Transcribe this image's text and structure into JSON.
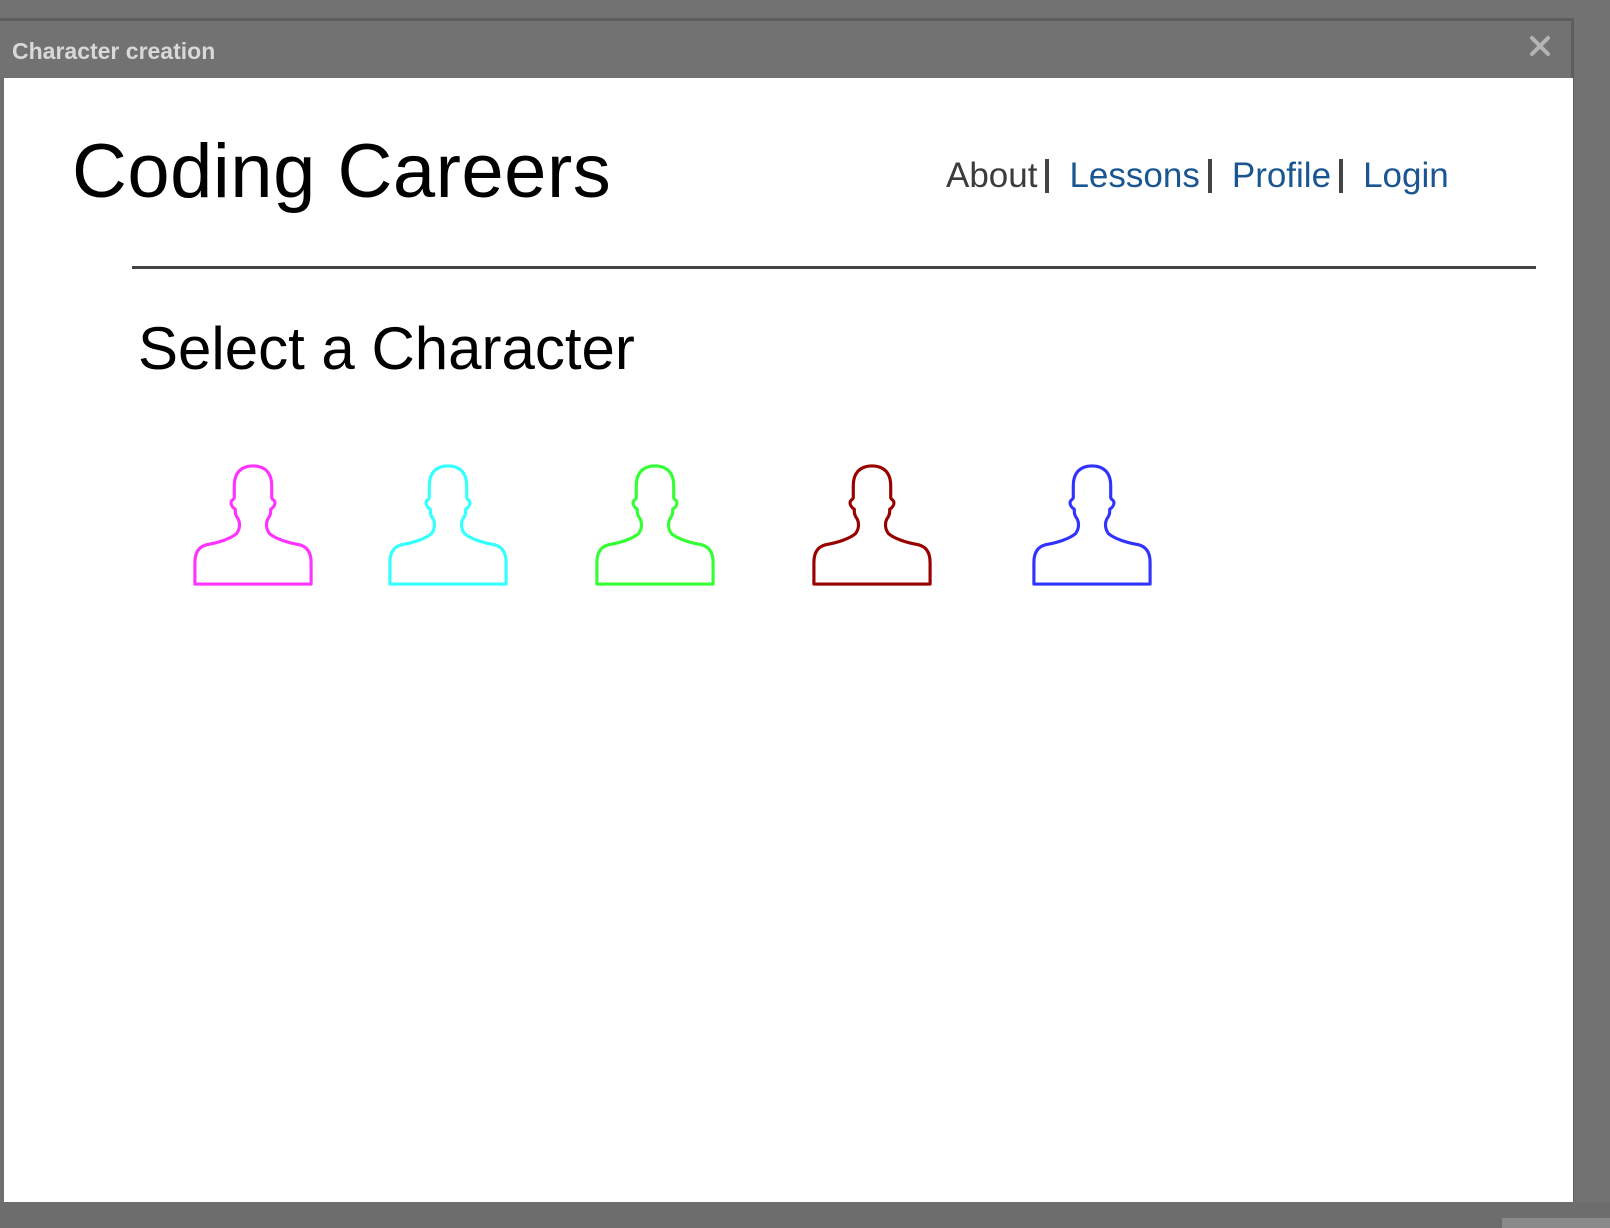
{
  "window": {
    "title": "Character creation",
    "close_icon": "close-icon"
  },
  "header": {
    "site_title": "Coding Careers",
    "nav": [
      {
        "label": "About",
        "color": "#3c3c3c"
      },
      {
        "label": "Lessons",
        "color": "#1a5692"
      },
      {
        "label": "Profile",
        "color": "#1a5692"
      },
      {
        "label": "Login",
        "color": "#1a5692"
      }
    ]
  },
  "main": {
    "heading": "Select a Character",
    "characters": [
      {
        "icon": "person-outline-icon",
        "color": "#ff33ff"
      },
      {
        "icon": "person-outline-icon",
        "color": "#33ffff"
      },
      {
        "icon": "person-outline-icon",
        "color": "#33ff33"
      },
      {
        "icon": "person-outline-icon",
        "color": "#990000"
      },
      {
        "icon": "person-outline-icon",
        "color": "#3333ff"
      }
    ]
  }
}
